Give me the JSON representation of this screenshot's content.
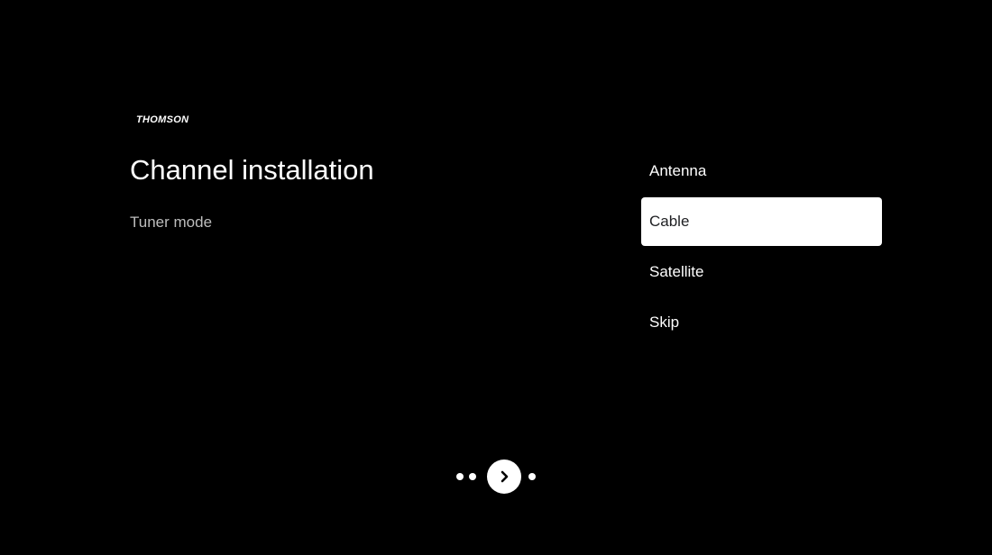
{
  "brand": {
    "logo_text": "THOMSON"
  },
  "header": {
    "title": "Channel installation",
    "subtitle": "Tuner mode"
  },
  "tuner_options": {
    "items": [
      {
        "label": "Antenna",
        "selected": false
      },
      {
        "label": "Cable",
        "selected": true
      },
      {
        "label": "Satellite",
        "selected": false
      },
      {
        "label": "Skip",
        "selected": false
      }
    ]
  },
  "pager": {
    "dots_before": 2,
    "dots_after": 1,
    "next_icon": "chevron-right-icon"
  },
  "colors": {
    "background": "#000000",
    "text": "#ffffff",
    "subtitle_text": "#bdbdbd",
    "selected_bg": "#ffffff",
    "selected_text": "#202124"
  }
}
